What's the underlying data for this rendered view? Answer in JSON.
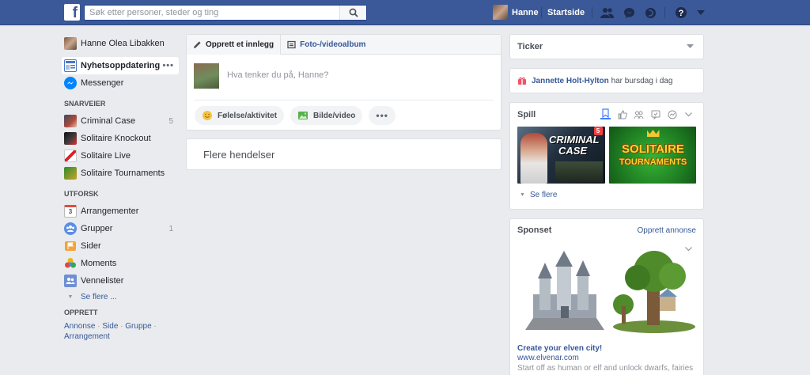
{
  "topbar": {
    "search_placeholder": "Søk etter personer, steder og ting",
    "user_name": "Hanne",
    "home_label": "Startside"
  },
  "sidebar": {
    "profile_name": "Hanne Olea Libakken",
    "main_items": [
      {
        "label": "Nyhetsoppdatering",
        "more": "•••",
        "icon": "news-feed-icon"
      },
      {
        "label": "Messenger",
        "icon": "messenger-icon"
      }
    ],
    "shortcuts_title": "SNARVEIER",
    "shortcuts": [
      {
        "label": "Criminal Case",
        "count": "5"
      },
      {
        "label": "Solitaire Knockout",
        "count": ""
      },
      {
        "label": "Solitaire Live",
        "count": ""
      },
      {
        "label": "Solitaire Tournaments",
        "count": ""
      }
    ],
    "explore_title": "UTFORSK",
    "explore": [
      {
        "label": "Arrangementer",
        "count": "",
        "icon_text": "3"
      },
      {
        "label": "Grupper",
        "count": "1"
      },
      {
        "label": "Sider",
        "count": ""
      },
      {
        "label": "Moments",
        "count": ""
      },
      {
        "label": "Vennelister",
        "count": ""
      }
    ],
    "see_more": "Se flere ...",
    "create_title": "OPPRETT",
    "create_links": [
      "Annonse",
      "Side",
      "Gruppe",
      "Arrangement"
    ],
    "create_sep": " · "
  },
  "composer": {
    "tab_post": "Opprett et innlegg",
    "tab_album": "Foto-/videoalbum",
    "placeholder": "Hva tenker du på, Hanne?",
    "action_feeling": "Følelse/aktivitet",
    "action_photo": "Bilde/video",
    "action_more": "•••"
  },
  "more_events": "Flere hendelser",
  "right": {
    "ticker_title": "Ticker",
    "birthday_name": "Jannette Holt-Hylton",
    "birthday_text": "har bursdag i dag",
    "games_title": "Spill",
    "game1_line1": "CRIMINAL",
    "game1_line2": "CASE",
    "game1_badge": "5",
    "game2_line1": "SOLITAIRE",
    "game2_line2": "TOURNAMENTS",
    "games_see_more": "Se flere",
    "sponsored_title": "Sponset",
    "create_ad": "Opprett annonse",
    "ad_title": "Create your elven city!",
    "ad_url": "www.elvenar.com",
    "ad_text": "Start off as human or elf and unlock dwarfs, fairies"
  },
  "colors": {
    "brand": "#3b5998",
    "link": "#365899",
    "background": "#e9ebee"
  }
}
